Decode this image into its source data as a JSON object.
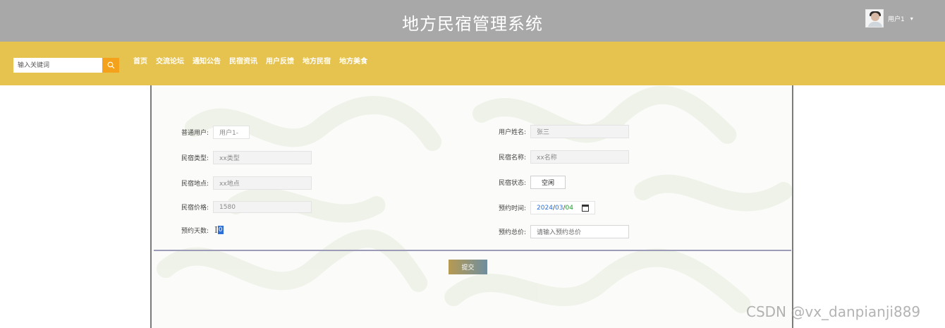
{
  "header": {
    "title": "地方民宿管理系统",
    "user_name": "用户1",
    "user_caret": "▾"
  },
  "nav": {
    "search_placeholder": "输入关键词",
    "items": [
      {
        "label": "首页"
      },
      {
        "label": "交流论坛"
      },
      {
        "label": "通知公告"
      },
      {
        "label": "民宿资讯"
      },
      {
        "label": "用户反馈"
      },
      {
        "label": "地方民宿"
      },
      {
        "label": "地方美食"
      }
    ]
  },
  "form": {
    "user": {
      "label": "普通用户:",
      "value": "用户1-"
    },
    "user_realname": {
      "label": "用户姓名:",
      "value": "张三"
    },
    "type": {
      "label": "民宿类型:",
      "value": "xx类型"
    },
    "name": {
      "label": "民宿名称:",
      "value": "xx名称"
    },
    "location": {
      "label": "民宿地点:",
      "value": "xx地点"
    },
    "status": {
      "label": "民宿状态:",
      "value": "空闲"
    },
    "price": {
      "label": "民宿价格:",
      "value": "1580"
    },
    "reserve_time": {
      "label": "预约时间:",
      "year": "2024",
      "sep": "/",
      "month": "03",
      "day": "04"
    },
    "reserve_days": {
      "label": "预约天数:",
      "value": "0"
    },
    "total_price": {
      "label": "预约总价:",
      "placeholder": "请输入预约总价"
    },
    "submit_label": "提交"
  },
  "watermark": "CSDN @vx_danpianji889",
  "colors": {
    "topbar": "#a8a8a8",
    "navbar": "#e6c24f",
    "search_button": "#f4a21c"
  }
}
